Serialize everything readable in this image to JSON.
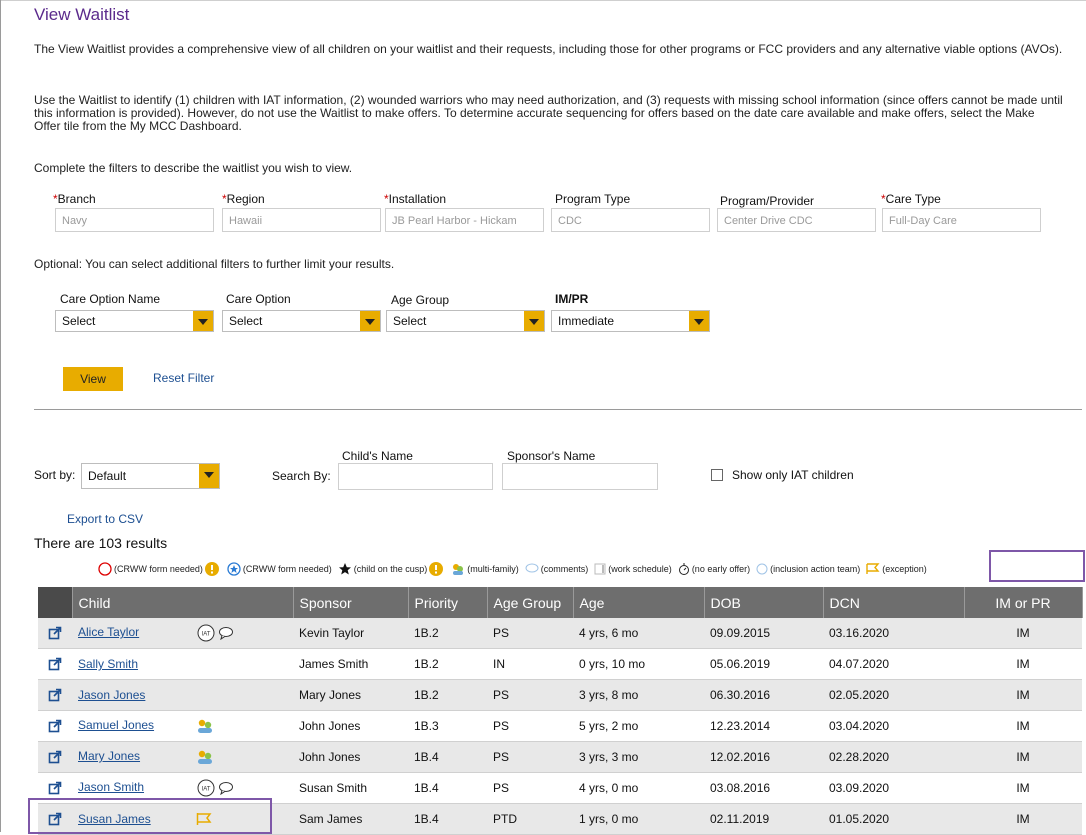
{
  "page": {
    "title": "View Waitlist",
    "intro": "The View Waitlist provides a comprehensive view of all children on your waitlist and their requests, including those for other programs or FCC providers and any alternative viable options (AVOs).",
    "instructions": "Use the Waitlist to identify (1) children with IAT information, (2) wounded warriors who may need authorization, and (3) requests with missing school information (since offers cannot be made until this information is provided). However, do not use the Waitlist to make offers. To determine accurate sequencing for offers based on the date care available and make offers, select the Make Offer tile from the My MCC Dashboard.",
    "filters_prompt": "Complete the filters to describe the waitlist you wish to view.",
    "optional_prompt": "Optional: You can select additional filters to further limit your results."
  },
  "filters": {
    "branch": {
      "label": "Branch",
      "value": "Navy"
    },
    "region": {
      "label": "Region",
      "value": "Hawaii"
    },
    "installation": {
      "label": "Installation",
      "value": "JB Pearl Harbor - Hickam"
    },
    "program_type": {
      "label": "Program Type",
      "value": "CDC"
    },
    "program_provider": {
      "label": "Program/Provider",
      "value": "Center Drive CDC"
    },
    "care_type": {
      "label": "Care Type",
      "value": "Full-Day Care"
    }
  },
  "optional": {
    "care_option_name": {
      "label": "Care Option Name",
      "value": "Select"
    },
    "care_option": {
      "label": "Care Option",
      "value": "Select"
    },
    "age_group": {
      "label": "Age Group",
      "value": "Select"
    },
    "im_pr": {
      "label": "IM/PR",
      "value": "Immediate"
    }
  },
  "actions": {
    "view": "View",
    "reset": "Reset Filter",
    "export": "Export to CSV"
  },
  "search": {
    "sort_label": "Sort by:",
    "sort_value": "Default",
    "search_by": "Search By:",
    "child_name": "Child's Name",
    "sponsor_name": "Sponsor's Name",
    "iat_only": "Show only IAT children"
  },
  "results_text": "There are 103 results",
  "legend": {
    "crww1": "(CRWW form needed)",
    "crww2": "(CRWW form needed)",
    "cusp": "(child on the cusp)",
    "multi": "(multi-family)",
    "comments": "(comments)",
    "work": "(work schedule)",
    "early": "(no early offer)",
    "iat": "(inclusion action team)",
    "exception": "(exception)"
  },
  "table": {
    "headers": [
      "Child",
      "Sponsor",
      "Priority",
      "Age Group",
      "Age",
      "DOB",
      "DCN",
      "IM or PR"
    ],
    "rows": [
      {
        "child": "Alice Taylor",
        "sponsor": "Kevin Taylor",
        "priority": "1B.2",
        "age_group": "PS",
        "age": "4 yrs, 6 mo",
        "dob": "09.09.2015",
        "dcn": "03.16.2020",
        "impr": "IM",
        "icons": "iat-comment"
      },
      {
        "child": "Sally Smith",
        "sponsor": "James Smith",
        "priority": "1B.2",
        "age_group": "IN",
        "age": "0 yrs, 10 mo",
        "dob": "05.06.2019",
        "dcn": "04.07.2020",
        "impr": "IM",
        "icons": ""
      },
      {
        "child": "Jason Jones",
        "sponsor": "Mary Jones",
        "priority": "1B.2",
        "age_group": "PS",
        "age": "3 yrs, 8 mo",
        "dob": "06.30.2016",
        "dcn": "02.05.2020",
        "impr": "IM",
        "icons": ""
      },
      {
        "child": "Samuel Jones",
        "sponsor": "John Jones",
        "priority": "1B.3",
        "age_group": "PS",
        "age": "5 yrs, 2 mo",
        "dob": "12.23.2014",
        "dcn": "03.04.2020",
        "impr": "IM",
        "icons": "multi"
      },
      {
        "child": "Mary Jones",
        "sponsor": "John Jones",
        "priority": "1B.4",
        "age_group": "PS",
        "age": "3 yrs, 3 mo",
        "dob": "12.02.2016",
        "dcn": "02.28.2020",
        "impr": "IM",
        "icons": "multi"
      },
      {
        "child": "Jason Smith",
        "sponsor": "Susan Smith",
        "priority": "1B.4",
        "age_group": "PS",
        "age": "4 yrs, 0 mo",
        "dob": "03.08.2016",
        "dcn": "03.09.2020",
        "impr": "IM",
        "icons": "iat-comment"
      },
      {
        "child": "Susan James",
        "sponsor": "Sam James",
        "priority": "1B.4",
        "age_group": "PTD",
        "age": "1 yrs, 0 mo",
        "dob": "02.11.2019",
        "dcn": "01.05.2020",
        "impr": "IM",
        "icons": "flag"
      }
    ]
  },
  "colors": {
    "accent": "#e8ac00",
    "title": "#5b2a8c",
    "link": "#1d4f91",
    "header": "#6e6e6e",
    "highlight": "#7e57a8"
  }
}
